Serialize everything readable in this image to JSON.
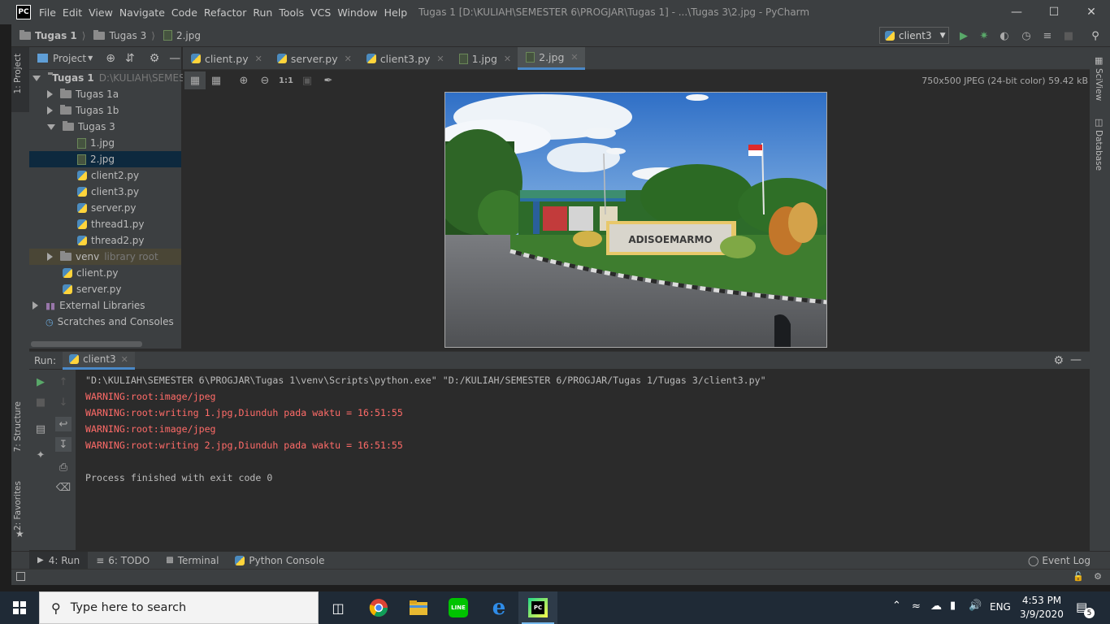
{
  "window": {
    "logo": "PC",
    "menu": [
      "File",
      "Edit",
      "View",
      "Navigate",
      "Code",
      "Refactor",
      "Run",
      "Tools",
      "VCS",
      "Window",
      "Help"
    ],
    "title": "Tugas 1 [D:\\KULIAH\\SEMESTER 6\\PROGJAR\\Tugas 1] - ...\\Tugas 3\\2.jpg - PyCharm"
  },
  "breadcrumb": [
    "Tugas 1",
    "Tugas 3",
    "2.jpg"
  ],
  "run_config": "client3",
  "left_strip": {
    "project_tab": "1: Project",
    "structure_tab": "7: Structure",
    "favorites_tab": "2: Favorites"
  },
  "right_strip": {
    "sciview_tab": "SciView",
    "database_tab": "Database"
  },
  "project": {
    "header": "Project",
    "tree": [
      {
        "label": "Tugas 1",
        "hint": "D:\\KULIAH\\SEMESTER",
        "kind": "folder",
        "state": "open"
      },
      {
        "label": "Tugas 1a",
        "kind": "folder",
        "state": "closed"
      },
      {
        "label": "Tugas 1b",
        "kind": "folder",
        "state": "closed"
      },
      {
        "label": "Tugas 3",
        "kind": "folder",
        "state": "open"
      },
      {
        "label": "1.jpg",
        "kind": "image"
      },
      {
        "label": "2.jpg",
        "kind": "image",
        "selected": true
      },
      {
        "label": "client2.py",
        "kind": "python"
      },
      {
        "label": "client3.py",
        "kind": "python"
      },
      {
        "label": "server.py",
        "kind": "python"
      },
      {
        "label": "thread1.py",
        "kind": "python"
      },
      {
        "label": "thread2.py",
        "kind": "python"
      },
      {
        "label": "venv",
        "hint": "library root",
        "kind": "folder",
        "state": "closed"
      },
      {
        "label": "client.py",
        "kind": "python"
      },
      {
        "label": "server.py",
        "kind": "python"
      },
      {
        "label": "External Libraries",
        "kind": "library",
        "state": "closed"
      },
      {
        "label": "Scratches and Consoles",
        "kind": "scratch"
      }
    ]
  },
  "editor_tabs": [
    {
      "label": "client.py",
      "kind": "python"
    },
    {
      "label": "server.py",
      "kind": "python"
    },
    {
      "label": "client3.py",
      "kind": "python"
    },
    {
      "label": "1.jpg",
      "kind": "image"
    },
    {
      "label": "2.jpg",
      "kind": "image",
      "active": true
    }
  ],
  "image_viewer": {
    "info": "750x500 JPEG (24-bit color) 59.42 kB",
    "zoom_actual": "1:1",
    "sign_text": "ADISOEMARMO"
  },
  "run_panel": {
    "label": "Run:",
    "tab": "client3",
    "console": [
      {
        "text": "\"D:\\KULIAH\\SEMESTER 6\\PROGJAR\\Tugas 1\\venv\\Scripts\\python.exe\" \"D:/KULIAH/SEMESTER 6/PROGJAR/Tugas 1/Tugas 3/client3.py\"",
        "kind": "normal"
      },
      {
        "text": "WARNING:root:image/jpeg",
        "kind": "warn"
      },
      {
        "text": "WARNING:root:writing 1.jpg,Diunduh pada waktu = 16:51:55",
        "kind": "warn"
      },
      {
        "text": "WARNING:root:image/jpeg",
        "kind": "warn"
      },
      {
        "text": "WARNING:root:writing 2.jpg,Diunduh pada waktu = 16:51:55",
        "kind": "warn"
      },
      {
        "text": "",
        "kind": "normal"
      },
      {
        "text": "Process finished with exit code 0",
        "kind": "normal"
      }
    ]
  },
  "bottom_tools": {
    "run": "4: Run",
    "todo": "6: TODO",
    "terminal": "Terminal",
    "python_console": "Python Console",
    "event_log": "Event Log"
  },
  "taskbar": {
    "search_placeholder": "Type here to search",
    "time": "4:53 PM",
    "date": "3/9/2020",
    "language": "ENG",
    "notification_count": "5"
  },
  "colors": {
    "accent": "#4a88c7",
    "warning": "#ff6b68",
    "selection": "#0d293e"
  }
}
